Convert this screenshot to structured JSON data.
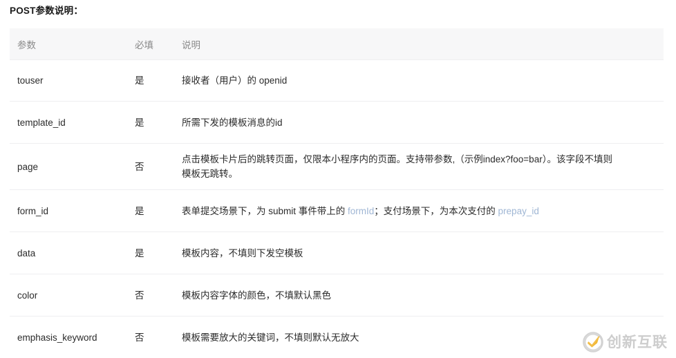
{
  "page": {
    "title": "POST参数说明："
  },
  "table": {
    "columns": [
      "参数",
      "必填",
      "说明"
    ],
    "rows": [
      {
        "param": "touser",
        "required": "是",
        "desc": "接收者（用户）的 openid",
        "desc_line2": ""
      },
      {
        "param": "template_id",
        "required": "是",
        "desc": "所需下发的模板消息的id",
        "desc_line2": ""
      },
      {
        "param": "page",
        "required": "否",
        "desc": "点击模板卡片后的跳转页面，仅限本小程序内的页面。支持带参数,（示例index?foo=bar）。该字段不填则",
        "desc_line2": "模板无跳转。"
      },
      {
        "param": "form_id",
        "required": "是",
        "desc_prefix": "表单提交场景下，为 submit 事件带上的 ",
        "desc_link1": "formId",
        "desc_middle": "；支付场景下，为本次支付的 ",
        "desc_link2": "prepay_id",
        "desc_line2": ""
      },
      {
        "param": "data",
        "required": "是",
        "desc": "模板内容，不填则下发空模板",
        "desc_line2": ""
      },
      {
        "param": "color",
        "required": "否",
        "desc": "模板内容字体的颜色，不填默认黑色",
        "desc_line2": ""
      },
      {
        "param": "emphasis_keyword",
        "required": "否",
        "desc": "模板需要放大的关键词，不填则默认无放大",
        "desc_line2": ""
      }
    ]
  },
  "watermark": {
    "text": "创新互联",
    "logo_icon": "creative-circle-logo-icon"
  },
  "colors": {
    "header_bg": "#f7f7f8",
    "header_text": "#8a8a8a",
    "body_text": "#2b2b2b",
    "row_border": "#eeeef0",
    "link": "#9fb6d4",
    "watermark_text": "#c9c9c9",
    "watermark_accent": "#f0b323"
  }
}
